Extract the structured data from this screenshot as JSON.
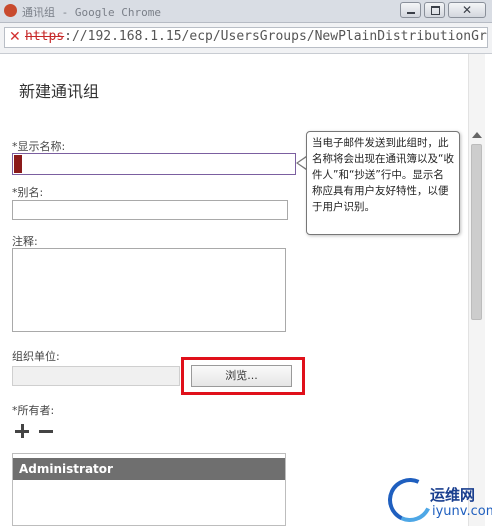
{
  "window": {
    "title": "通讯组 - Google Chrome"
  },
  "address_bar": {
    "scheme": "https",
    "url_rest": "://192.168.1.15/ecp/UsersGroups/NewPlainDistributionGro"
  },
  "page": {
    "heading": "新建通讯组",
    "display_name": {
      "label": "*显示名称:",
      "value": ""
    },
    "alias": {
      "label": "*别名:",
      "value": ""
    },
    "notes": {
      "label": "注释:",
      "value": ""
    },
    "org_unit": {
      "label": "组织单位:",
      "value": "",
      "browse_label": "浏览..."
    },
    "owners": {
      "label": "*所有者:",
      "items": [
        "Administrator"
      ]
    },
    "tooltip": "当电子邮件发送到此组时，此名称将会出现在通讯簿以及“收件人”和“抄送”行中。显示名称应具有用户友好特性，以便于用户识别。"
  },
  "watermark": {
    "name": "运维网",
    "url": "iyunv.com"
  },
  "colors": {
    "highlight": "#e0101a",
    "selected_row": "#6f6f6f"
  }
}
